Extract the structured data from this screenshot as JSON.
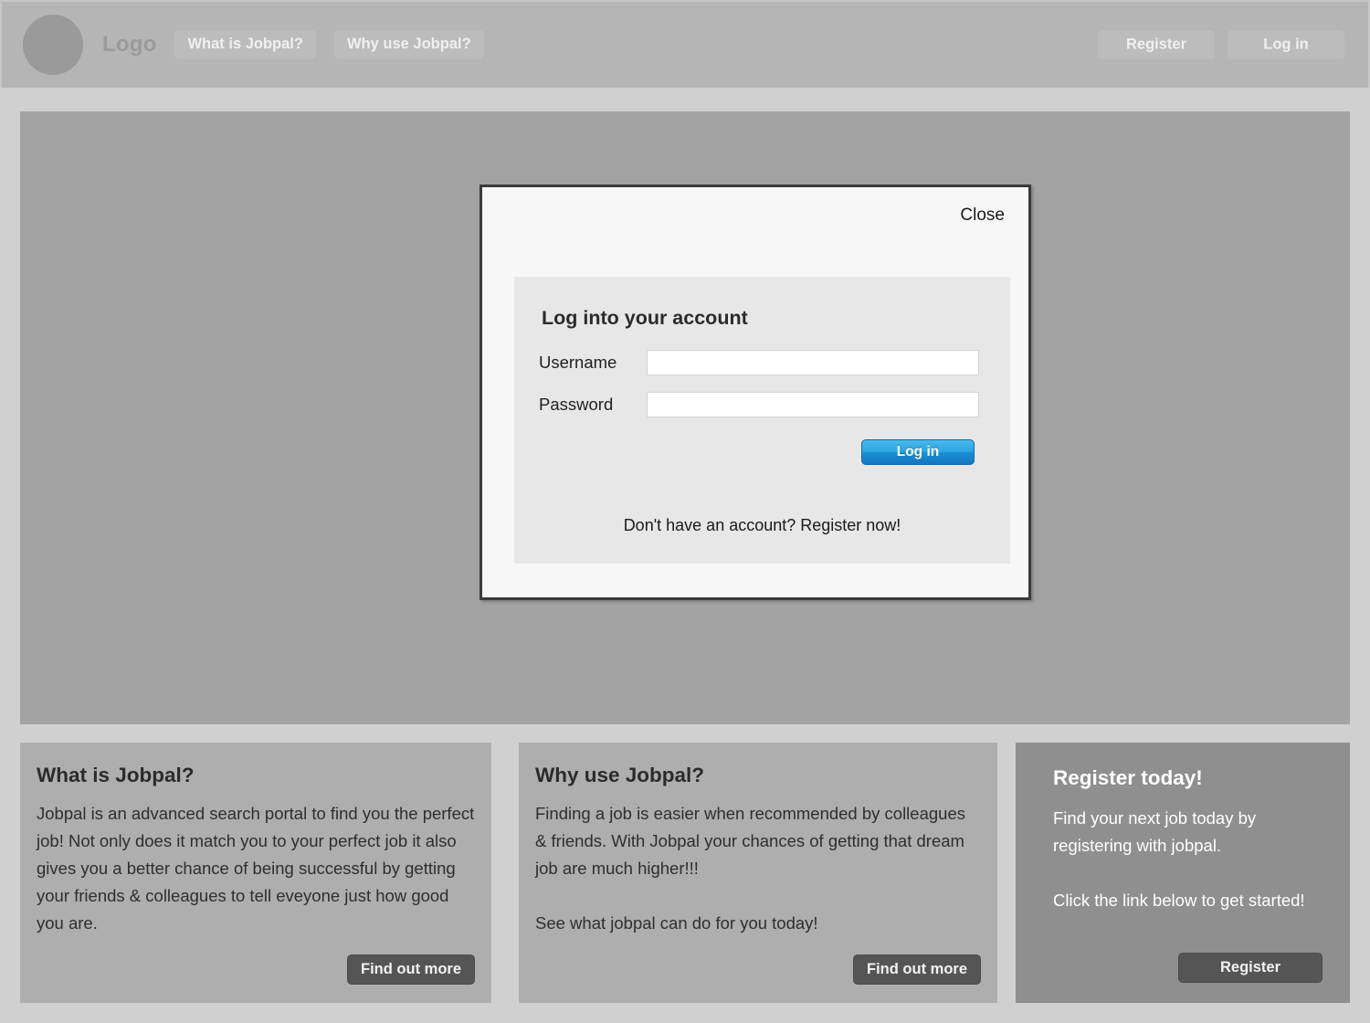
{
  "header": {
    "logo_icon": "logo-circle-icon",
    "logo_text": "Logo",
    "nav_left": [
      {
        "label": "What is Jobpal?"
      },
      {
        "label": "Why use Jobpal?"
      }
    ],
    "nav_right": [
      {
        "label": "Register"
      },
      {
        "label": "Log in"
      }
    ]
  },
  "modal": {
    "close_label": "Close",
    "title": "Log into your account",
    "fields": [
      {
        "label": "Username",
        "value": "",
        "placeholder": ""
      },
      {
        "label": "Password",
        "value": "",
        "placeholder": ""
      }
    ],
    "submit_label": "Log in",
    "register_prompt": "Don't have an account? Register now!"
  },
  "cards": [
    {
      "title": "What is Jobpal?",
      "body": "Jobpal is an advanced search portal to find you the perfect job! Not only does it match you to your perfect job it also gives you a better chance of being successful by getting your friends & colleagues to tell eveyone just how good you are.",
      "button": "Find out more"
    },
    {
      "title": "Why use Jobpal?",
      "body": "Finding a job is easier when recommended by colleagues & friends. With Jobpal your chances of getting that dream job are much higher!!!\n\nSee what jobpal can do for you today!",
      "button": "Find out more"
    },
    {
      "title": "Register today!",
      "body": "Find your next job today by registering with jobpal.\n\nClick the link below to get started!",
      "button": "Register"
    }
  ],
  "colors": {
    "page_background": "#d0d0d0",
    "header_background": "#b5b5b5",
    "hero_background": "#a3a3a3",
    "card_background": "#aeaeae",
    "card_highlight_background": "#8f8f8f",
    "modal_background": "#f7f7f7",
    "form_panel_background": "#e7e7e7",
    "primary_button": "#1f95d8",
    "dark_button": "#555555"
  }
}
